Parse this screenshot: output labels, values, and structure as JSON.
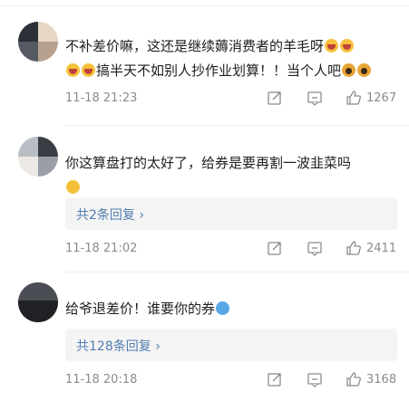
{
  "comments": [
    {
      "text": "不补差价嘛，这还是继续薅消费者的羊毛呀",
      "text2": "搞半天不如别人抄作业划算！！当个人吧",
      "time": "11-18 21:23",
      "likes": "1267"
    },
    {
      "text": "你这算盘打的太好了，给券是要再割一波韭菜吗",
      "reply_link": "共2条回复",
      "time": "11-18 21:02",
      "likes": "2411"
    },
    {
      "text": "给爷退差价！谁要你的券",
      "reply_link": "共128条回复",
      "time": "11-18 20:18",
      "likes": "3168"
    }
  ],
  "icons": {
    "repost": "repost-icon",
    "comment": "comment-icon",
    "like": "thumbs-up-icon",
    "chevron": "chevron-right-icon"
  },
  "colors": {
    "link": "#507daf",
    "meta": "#8b8b8b",
    "reply_bg": "#f4f4f4"
  }
}
